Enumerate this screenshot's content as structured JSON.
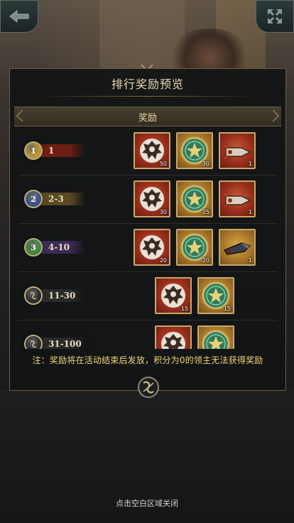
{
  "title": "排行奖励预览",
  "column_header": "奖励",
  "rows": [
    {
      "rank_label": "1",
      "badge": "1",
      "badge_color": "#b89638",
      "ribbon_color": "#6d1e12",
      "items": [
        {
          "icon": "heraldic-crest-icon",
          "frame": "red",
          "count": "50"
        },
        {
          "icon": "green-star-medal-icon",
          "frame": "gold",
          "count": "30"
        },
        {
          "icon": "ornate-weapon-icon",
          "frame": "red",
          "count": "1"
        }
      ]
    },
    {
      "rank_label": "2-3",
      "badge": "2",
      "badge_color": "#3a4f8c",
      "ribbon_color": "#5a4a22",
      "items": [
        {
          "icon": "heraldic-crest-icon",
          "frame": "red",
          "count": "30"
        },
        {
          "icon": "green-star-medal-icon",
          "frame": "gold",
          "count": "25"
        },
        {
          "icon": "ornate-weapon-icon",
          "frame": "red",
          "count": "1"
        }
      ]
    },
    {
      "rank_label": "4-10",
      "badge": "3",
      "badge_color": "#3f8a3a",
      "ribbon_color": "#3d2a57",
      "items": [
        {
          "icon": "heraldic-crest-icon",
          "frame": "red",
          "count": "20"
        },
        {
          "icon": "green-star-medal-icon",
          "frame": "gold",
          "count": "20"
        },
        {
          "icon": "dark-weapon-icon",
          "frame": "gold",
          "count": "1"
        }
      ]
    },
    {
      "rank_label": "11-30",
      "badge": "",
      "badge_color": "#2b2b2b",
      "ribbon_color": "#2a2a2a",
      "items": [
        {
          "icon": "heraldic-crest-icon",
          "frame": "red",
          "count": "15"
        },
        {
          "icon": "green-star-medal-icon",
          "frame": "gold",
          "count": "15"
        }
      ]
    },
    {
      "rank_label": "31-100",
      "badge": "",
      "badge_color": "#2b2b2b",
      "ribbon_color": "#2a2a2a",
      "items": [
        {
          "icon": "heraldic-crest-icon",
          "frame": "red",
          "count": ""
        },
        {
          "icon": "green-star-medal-icon",
          "frame": "gold",
          "count": ""
        }
      ]
    }
  ],
  "note": "注：奖励将在活动结束后发放，积分为0的领主无法获得奖励",
  "close_hint": "点击空白区域关闭",
  "colors": {
    "accent_gold": "#c9a96a",
    "note_yellow": "#f3d776"
  }
}
